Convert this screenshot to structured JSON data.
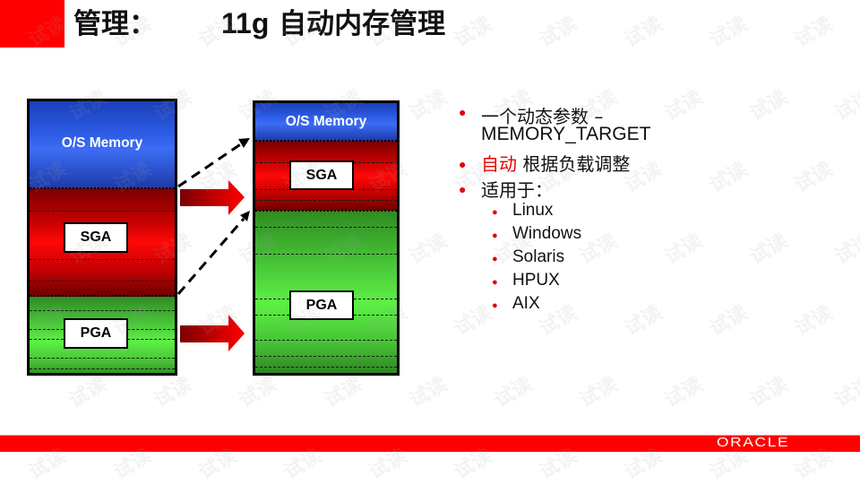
{
  "slide": {
    "title_prefix": "管理：",
    "title_main_latin": "11g",
    "title_main_cjk": " 自动内存管理"
  },
  "diagram": {
    "before": {
      "os_label": "O/S Memory",
      "sga_label": "SGA",
      "pga_label": "PGA"
    },
    "after": {
      "os_label": "O/S Memory",
      "sga_label": "SGA",
      "pga_label": "PGA"
    },
    "colors": {
      "os": "#2f5ee8",
      "sga": "#ff0808",
      "pga": "#5ef046",
      "arrow": "#ff0000"
    }
  },
  "bullets": {
    "items": [
      {
        "line1": "一个动态参数   –",
        "line2": "MEMORY_TARGET"
      },
      {
        "highlight": "自动",
        "rest": " 根据负载调整"
      },
      {
        "text": "适用于："
      }
    ],
    "platforms": [
      "Linux",
      "Windows",
      "Solaris",
      "HPUX",
      "AIX"
    ],
    "bullet_color": "#e00000",
    "highlight_color": "#e60000"
  },
  "footer": {
    "logo_text": "ORACLE",
    "bar_color": "#ff0000"
  },
  "watermark": {
    "text": "试读"
  }
}
